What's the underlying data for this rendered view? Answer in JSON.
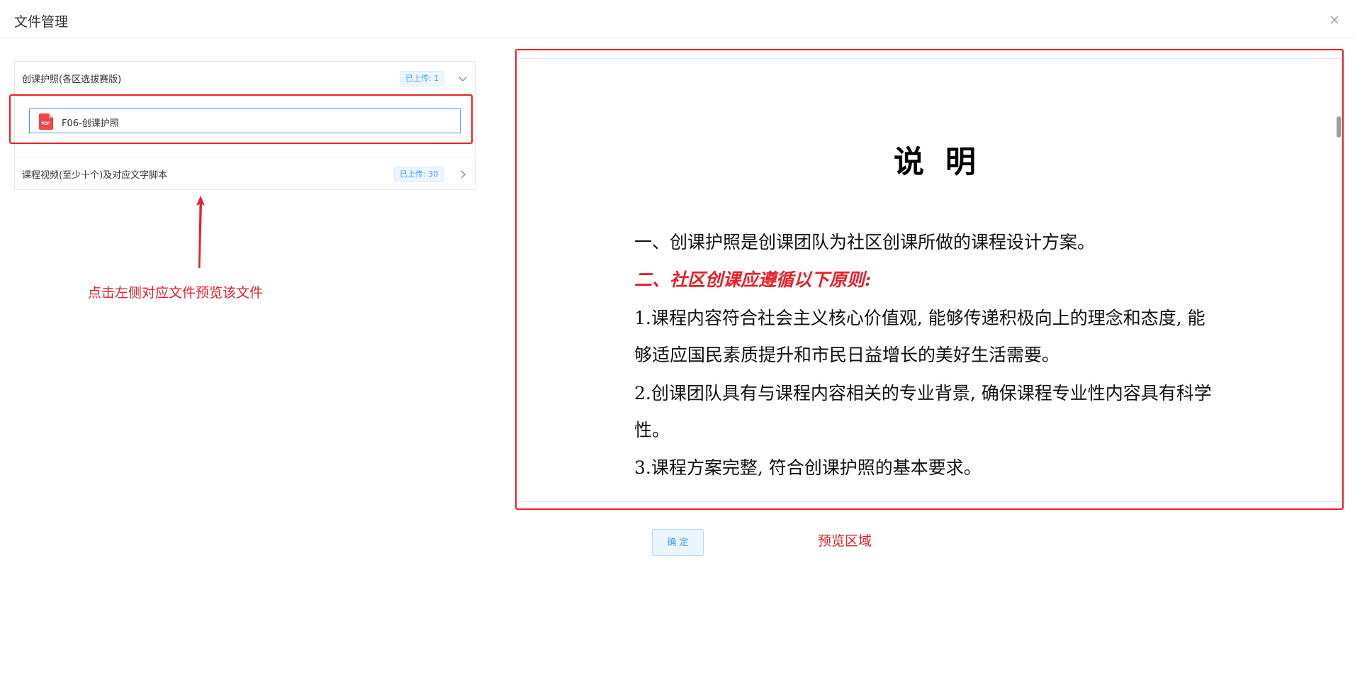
{
  "dialog": {
    "title": "文件管理"
  },
  "file_groups": [
    {
      "label": "创课护照(各区选拔赛版)",
      "badge": "已上传: 1",
      "expanded": true,
      "files": [
        {
          "name": "F06-创课护照",
          "icon": "pdf-icon",
          "icon_text": "PDF"
        }
      ]
    },
    {
      "label": "课程视频(至少十个)及对应文字脚本",
      "badge": "已上传: 30",
      "expanded": false
    }
  ],
  "annotations": {
    "left_hint": "点击左侧对应文件预览该文件",
    "right_hint": "预览区域",
    "color": "#e8202a"
  },
  "preview": {
    "doc_title": "说明",
    "lines": [
      "一、创课护照是创课团队为社区创课所做的课程设计方案。",
      "二、社区创课应遵循以下原则:",
      "1.课程内容符合社会主义核心价值观, 能够传递积极向上的理念和态度, 能",
      "够适应国民素质提升和市民日益增长的美好生活需要。",
      "2.创课团队具有与课程内容相关的专业背景, 确保课程专业性内容具有科学",
      "性。",
      "3.课程方案完整, 符合创课护照的基本要求。"
    ],
    "highlight_color": "#e8202a"
  },
  "footer": {
    "confirm_label": "确 定"
  },
  "colors": {
    "accent": "#409eff",
    "annotation_red": "#e8202a"
  }
}
